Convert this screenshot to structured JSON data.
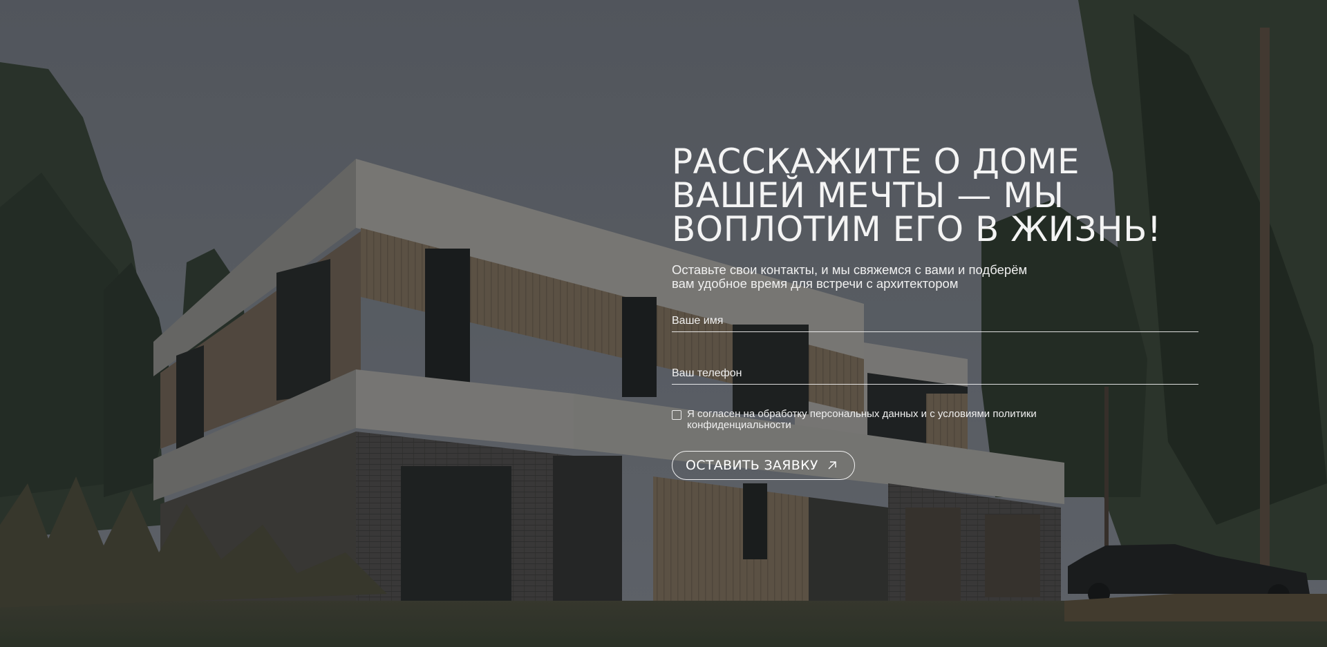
{
  "hero": {
    "headline": [
      "РАССКАЖИТЕ О ДОМЕ",
      "ВАШЕЙ МЕЧТЫ — МЫ",
      "ВОПЛОТИМ ЕГО В ЖИЗНЬ!"
    ],
    "subtitle": [
      "Оставьте свои контакты, и мы свяжемся с вами и подберём",
      "вам удобное время для встречи с архитектором"
    ],
    "background_image": "modern-two-storey-house-in-pine-forest"
  },
  "form": {
    "name_placeholder": "Ваше имя",
    "name_value": "",
    "phone_placeholder": "Ваш телефон",
    "phone_value": "",
    "consent_checked": false,
    "consent_text": [
      "Я согласен на обработку персональных данных и с условиями политики",
      "конфиденциальности"
    ],
    "submit_label": "ОСТАВИТЬ ЗАЯВКУ",
    "submit_icon": "arrow-up-right-icon"
  },
  "colors": {
    "text": "#ffffff",
    "overlay": "#4a4f58"
  }
}
